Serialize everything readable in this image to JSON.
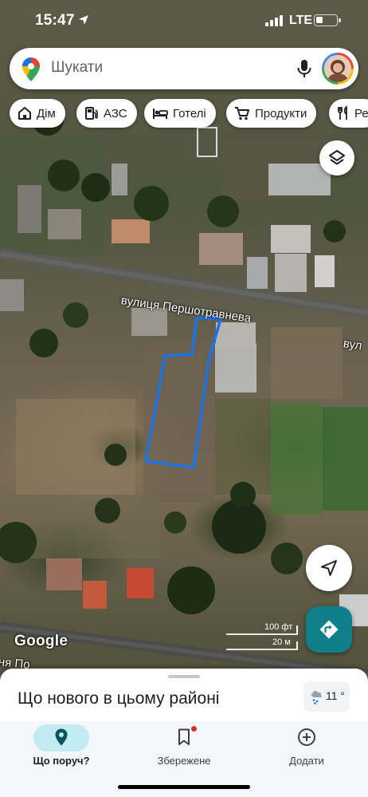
{
  "status_bar": {
    "time": "15:47",
    "network": "LTE"
  },
  "search": {
    "placeholder": "Шукати"
  },
  "chips": [
    {
      "label": "Дім",
      "icon": "home-icon"
    },
    {
      "label": "АЗС",
      "icon": "gas-station-icon"
    },
    {
      "label": "Готелі",
      "icon": "hotel-bed-icon"
    },
    {
      "label": "Продукти",
      "icon": "shopping-cart-icon"
    },
    {
      "label": "Ре",
      "icon": "restaurant-icon"
    }
  ],
  "map": {
    "street_label_1": "вулиця Першотравнева",
    "street_label_2": "вул",
    "street_label_3": "ня По",
    "google_logo": "Google",
    "scale_ft": "100 фт",
    "scale_m": "20 м",
    "plot_outline_color": "#1a73e8"
  },
  "sheet": {
    "title": "Що нового в цьому районі",
    "weather_temp": "11 °"
  },
  "nav": {
    "items": [
      {
        "label": "Що поруч?",
        "icon": "explore-pin-icon",
        "active": true
      },
      {
        "label": "Збережене",
        "icon": "bookmark-icon",
        "active": false
      },
      {
        "label": "Додати",
        "icon": "add-circle-icon",
        "active": false
      }
    ]
  },
  "colors": {
    "accent": "#0f7f8c",
    "nav_active_pill": "#c3ecf2"
  }
}
